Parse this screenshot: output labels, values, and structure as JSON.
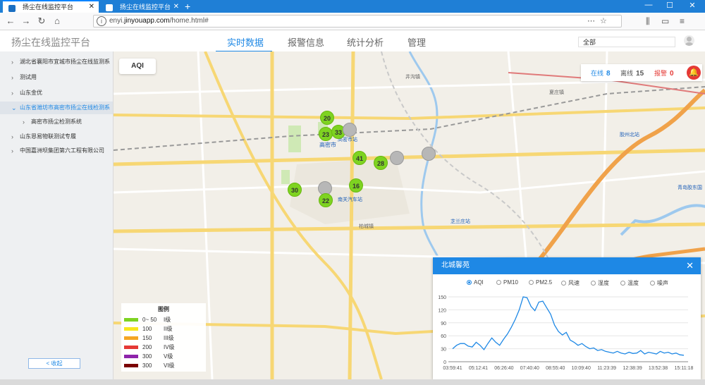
{
  "browser": {
    "tabs": [
      {
        "title": "扬尘在线监控平台",
        "active": true
      },
      {
        "title": "扬尘在线监控平台",
        "active": false
      }
    ],
    "url_prefix": "enyi.",
    "url_domain": "jinyouapp.com",
    "url_path": "/home.html#"
  },
  "app": {
    "title": "扬尘在线监控平台",
    "nav": [
      {
        "label": "实时数据",
        "active": true
      },
      {
        "label": "报警信息",
        "active": false
      },
      {
        "label": "统计分析",
        "active": false
      },
      {
        "label": "管理",
        "active": false
      }
    ],
    "filter_value": "全部"
  },
  "sidebar": {
    "items": [
      {
        "label": "湖北省襄阳市宜城市扬尘在线监测系",
        "arrow": "›",
        "selected": false,
        "child": false
      },
      {
        "label": "测试用",
        "arrow": "›",
        "selected": false,
        "child": false
      },
      {
        "label": "山东金优",
        "arrow": "›",
        "selected": false,
        "child": false
      },
      {
        "label": "山东省潍坊市高密市扬尘在线检测系",
        "arrow": "⌄",
        "selected": true,
        "child": false
      },
      {
        "label": "高密市扬尘检测系统",
        "arrow": "›",
        "selected": false,
        "child": true
      },
      {
        "label": "山东恩易物联测试专履",
        "arrow": "›",
        "selected": false,
        "child": false
      },
      {
        "label": "中国嘉洲坝集团第六工程有限公司",
        "arrow": "›",
        "selected": false,
        "child": false
      }
    ],
    "collapse_label": "< 收起"
  },
  "map": {
    "aqi_tab": "AQI",
    "status": {
      "online_label": "在线",
      "online_count": "8",
      "offline_label": "离线",
      "offline_count": "15",
      "alarm_label": "报警",
      "alarm_count": "0"
    },
    "markers": [
      {
        "value": "20",
        "color": "green"
      },
      {
        "value": "23",
        "color": "green"
      },
      {
        "value": "33",
        "color": "green"
      },
      {
        "value": "",
        "color": "gray"
      },
      {
        "value": "41",
        "color": "green"
      },
      {
        "value": "28",
        "color": "green"
      },
      {
        "value": "",
        "color": "gray"
      },
      {
        "value": "",
        "color": "gray"
      },
      {
        "value": "30",
        "color": "green"
      },
      {
        "value": "",
        "color": "gray"
      },
      {
        "value": "16",
        "color": "green"
      },
      {
        "value": "22",
        "color": "green"
      }
    ],
    "place_labels": [
      "井沟镇",
      "高密市",
      "高密市站",
      "南关汽车站",
      "胶州北站",
      "青岛胶东国",
      "芝兰庄站",
      "柏城镇",
      "夏庄镇"
    ]
  },
  "legend": {
    "title": "图例",
    "rows": [
      {
        "range": "0~ 50",
        "level": "I级",
        "color": "#7ed321"
      },
      {
        "range": "100",
        "level": "II级",
        "color": "#f8e71c"
      },
      {
        "range": "150",
        "level": "III级",
        "color": "#f5a623"
      },
      {
        "range": "200",
        "level": "IV级",
        "color": "#e53935"
      },
      {
        "range": "300",
        "level": "V级",
        "color": "#8e24aa"
      },
      {
        "range": "300",
        "level": "VI级",
        "color": "#7b0000"
      }
    ]
  },
  "popup": {
    "title": "北城馨苑",
    "close": "✕",
    "options": [
      {
        "label": "AQI",
        "selected": true
      },
      {
        "label": "PM10",
        "selected": false
      },
      {
        "label": "PM2.5",
        "selected": false
      },
      {
        "label": "风速",
        "selected": false
      },
      {
        "label": "湿度",
        "selected": false
      },
      {
        "label": "温度",
        "selected": false
      },
      {
        "label": "噪声",
        "selected": false
      }
    ]
  },
  "chart_data": {
    "type": "line",
    "title": "",
    "xlabel": "",
    "ylabel": "",
    "ylim": [
      0,
      150
    ],
    "yticks": [
      0,
      30,
      60,
      90,
      120,
      150
    ],
    "xticks": [
      "03:59:41",
      "05:12:41",
      "06:26:40",
      "07:40:40",
      "08:55:40",
      "10:09:40",
      "11:23:39",
      "12:38:39",
      "13:52:38",
      "15:11:18"
    ],
    "series": [
      {
        "name": "",
        "color": "#1e88e5",
        "values": [
          30,
          38,
          42,
          42,
          36,
          34,
          45,
          38,
          28,
          42,
          55,
          45,
          38,
          52,
          64,
          80,
          98,
          120,
          150,
          148,
          128,
          118,
          138,
          140,
          125,
          110,
          85,
          70,
          62,
          68,
          50,
          45,
          38,
          42,
          35,
          30,
          32,
          26,
          28,
          24,
          22,
          20,
          24,
          20,
          18,
          22,
          19,
          20,
          26,
          18,
          22,
          20,
          18,
          24,
          20,
          22,
          18,
          20,
          16,
          15
        ]
      }
    ]
  }
}
